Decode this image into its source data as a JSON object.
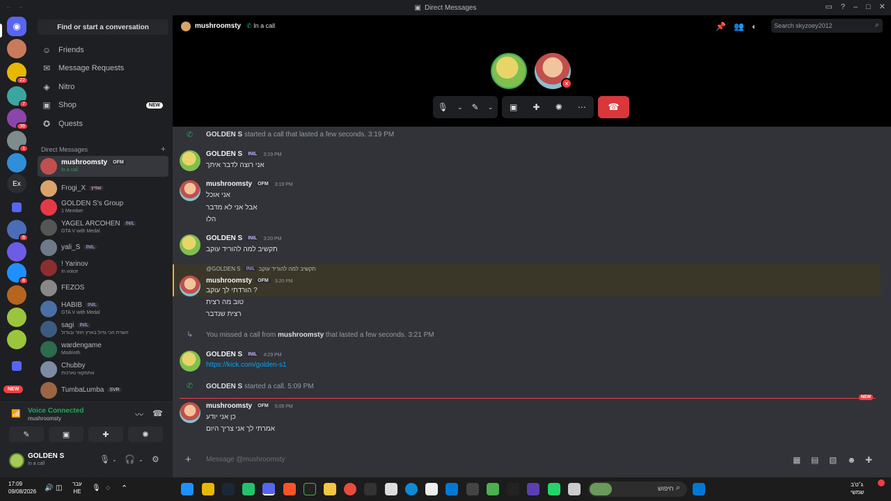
{
  "window": {
    "title": "Direct Messages"
  },
  "sidebar": {
    "find_placeholder": "Find or start a conversation",
    "nav": [
      {
        "label": "Friends"
      },
      {
        "label": "Message Requests"
      },
      {
        "label": "Nitro"
      },
      {
        "label": "Shop",
        "badge": "NEW"
      },
      {
        "label": "Quests"
      }
    ],
    "dm_header": "Direct Messages",
    "dms": [
      {
        "name": "mushroomsty",
        "tag": "OFM",
        "sub": "In a call"
      },
      {
        "name": "Frogi_X",
        "tag": "שפיץ",
        "sub": ""
      },
      {
        "name": "GOLDEN S's Group",
        "tag": "",
        "sub": "1 Member"
      },
      {
        "name": "YAGEL ARCOHEN",
        "tag": "INIL",
        "sub": "GTA V with Medal"
      },
      {
        "name": "yali_S",
        "tag": "INIL",
        "sub": ""
      },
      {
        "name": "! Yarinov",
        "tag": "",
        "sub": "In voice"
      },
      {
        "name": "FEZOS",
        "tag": "",
        "sub": ""
      },
      {
        "name": "HABIB",
        "tag": "INIL",
        "sub": "GTA V with Medal"
      },
      {
        "name": "sagi",
        "tag": "INIL",
        "sub": "השרת הכי גדול בארץ חוזר ובגדול"
      },
      {
        "name": "wardengame",
        "tag": "",
        "sub": "Modrinth"
      },
      {
        "name": "Chubby",
        "tag": "",
        "sub": "אתמקאי נארכות"
      },
      {
        "name": "TumbaLumba",
        "tag": "SVR",
        "sub": ""
      }
    ],
    "rail_badges": [
      "22",
      "7",
      "36",
      "1",
      "6",
      "8"
    ],
    "rail_new": "NEW"
  },
  "voice": {
    "status": "Voice Connected",
    "channel": "mushroomsty"
  },
  "user": {
    "name": "GOLDEN S",
    "status": "In a call"
  },
  "header": {
    "name": "mushroomsty",
    "status": "In a call",
    "search_placeholder": "Search skyzoey2012"
  },
  "chat": {
    "messages": [
      {
        "kind": "system",
        "author": "GOLDEN S",
        "text": "started a call that lasted a few seconds.",
        "time": "3:19 PM"
      },
      {
        "kind": "message",
        "author": "GOLDEN S",
        "tag": "INIL",
        "time": "3:19 PM",
        "lines": [
          "אני רוצה לדבר איתך"
        ]
      },
      {
        "kind": "message",
        "author": "mushroomsty",
        "tag": "OFM",
        "time": "3:19 PM",
        "lines": [
          "אני אוכל",
          "אבל אני לא מדבר",
          "הלו"
        ]
      },
      {
        "kind": "message",
        "author": "GOLDEN S",
        "tag": "INIL",
        "time": "3:20 PM",
        "lines": [
          "תקשיב למה להוריד עוקב"
        ]
      },
      {
        "kind": "message",
        "author": "mushroomsty",
        "tag": "OFM",
        "time": "3:20 PM",
        "reply": "@GOLDEN S",
        "reply_tag": "INIL",
        "reply_text": "תקשיב למה להוריד עוקב",
        "lines": [
          "הורדתי לך עוקב ?",
          "טוב מה רצית",
          "רצית שנדבר"
        ]
      },
      {
        "kind": "system",
        "prefix": "You missed a call from",
        "author": "mushroomsty",
        "text": "that lasted a few seconds.",
        "time": "3:21 PM"
      },
      {
        "kind": "message",
        "author": "GOLDEN S",
        "tag": "INIL",
        "time": "4:29 PM",
        "lines": [
          "https://kick.com/golden-s1"
        ]
      },
      {
        "kind": "system",
        "author": "GOLDEN S",
        "text": "started a call.",
        "time": "5:09 PM"
      },
      {
        "kind": "message",
        "author": "mushroomsty",
        "tag": "OFM",
        "time": "5:09 PM",
        "lines": [
          "כן אני יודע",
          "אמרתי לך אני צריך היום"
        ]
      }
    ],
    "new_label": "NEW"
  },
  "composer": {
    "placeholder": "Message @mushroomsty"
  },
  "taskbar": {
    "time": "17:09",
    "date": "09/08/2026",
    "lang_top": "עבר",
    "lang_bottom": "HE",
    "search_label": "חיפוש",
    "right_top": "ג׳ט'ב",
    "right_bottom": "שמשי"
  },
  "colors": {
    "accent": "#5865f2",
    "online": "#23a55a",
    "danger": "#da373c",
    "link": "#00a8fc"
  }
}
